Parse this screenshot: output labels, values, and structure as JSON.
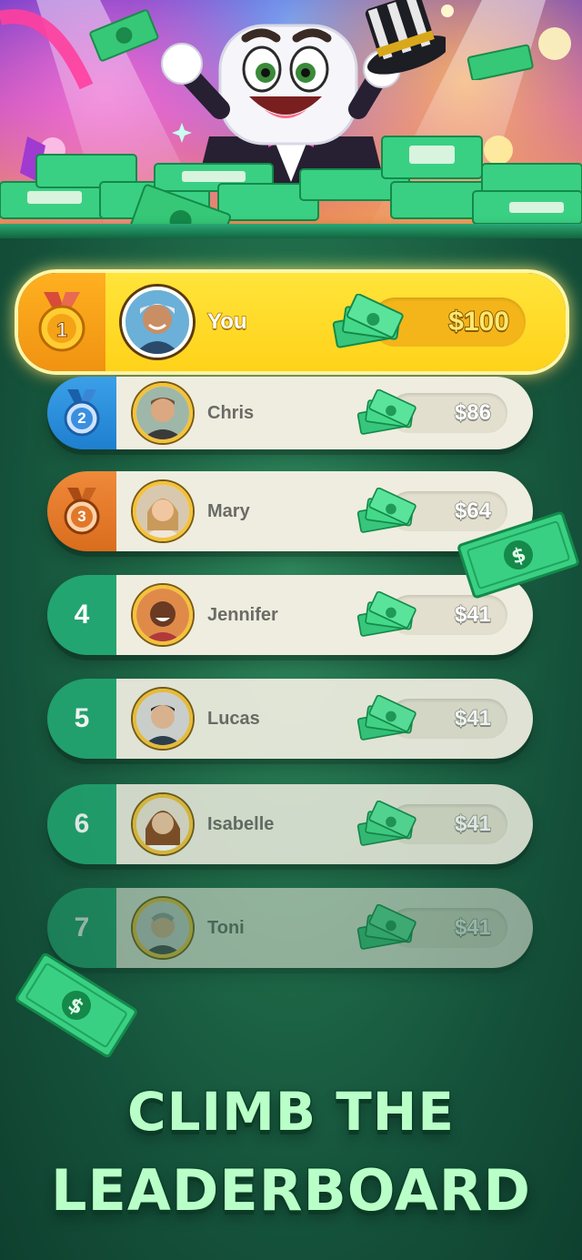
{
  "leaderboard": [
    {
      "rank": "1",
      "name": "You",
      "amount": "$100"
    },
    {
      "rank": "2",
      "name": "Chris",
      "amount": "$86"
    },
    {
      "rank": "3",
      "name": "Mary",
      "amount": "$64"
    },
    {
      "rank": "4",
      "name": "Jennifer",
      "amount": "$41"
    },
    {
      "rank": "5",
      "name": "Lucas",
      "amount": "$41"
    },
    {
      "rank": "6",
      "name": "Isabelle",
      "amount": "$41"
    },
    {
      "rank": "7",
      "name": "Toni",
      "amount": "$41"
    }
  ],
  "tagline": {
    "line1": "CLIMB THE",
    "line2": "LEADERBOARD"
  },
  "colors": {
    "gold": "#ffd21a",
    "silver_blue": "#1f7fcf",
    "bronze": "#d96d1d",
    "green": "#22a571",
    "card": "#efede0",
    "tagline": "#b9ffc8"
  },
  "icons": {
    "medal_gold": "medal-gold-icon",
    "medal_silver": "medal-silver-icon",
    "medal_bronze": "medal-bronze-icon",
    "cash": "cash-stack-icon"
  }
}
